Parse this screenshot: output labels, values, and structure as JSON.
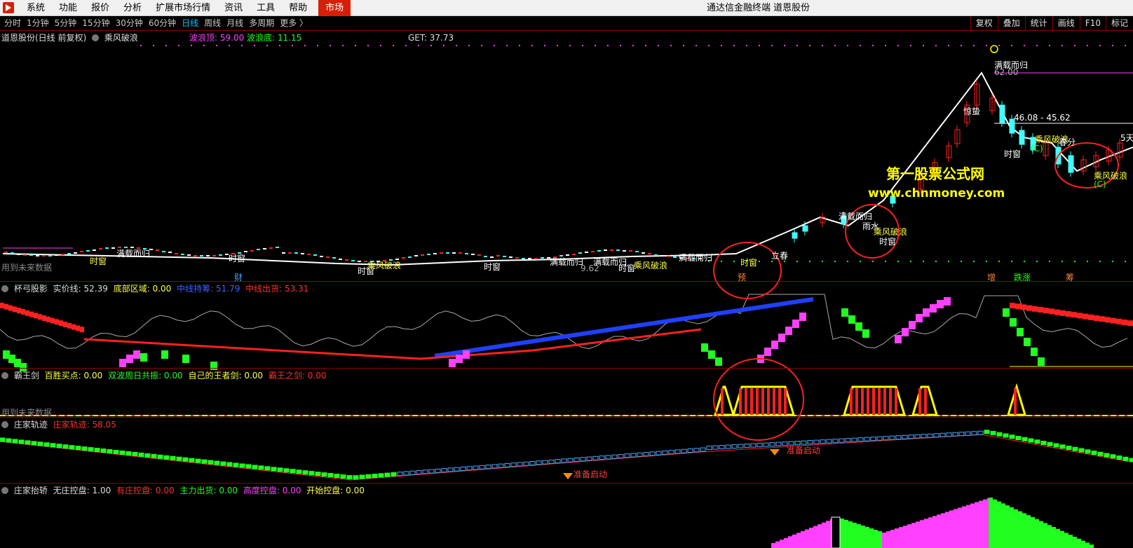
{
  "menu": {
    "items": [
      "系统",
      "功能",
      "报价",
      "分析",
      "扩展市场行情",
      "资讯",
      "工具",
      "帮助"
    ],
    "market": "市场",
    "title": "通达信金融终端 道恩股份"
  },
  "toolbar": {
    "periods": [
      "分时",
      "1分钟",
      "5分钟",
      "15分钟",
      "30分钟",
      "60分钟",
      "日线",
      "周线",
      "月线",
      "多周期",
      "更多 〉"
    ],
    "active": "日线",
    "right": [
      "复权",
      "叠加",
      "统计",
      "画线",
      "F10",
      "标记"
    ]
  },
  "panels": {
    "main": {
      "name": "道恩股份(日线 前复权)",
      "indicator": "乘风破浪",
      "wave_top": "波浪顶: 59.00",
      "wave_bottom": "波浪底: 11.15",
      "get": "GET: 37.73",
      "future_note": "用到未来数据",
      "price_range": "46.08 - 45.62",
      "peak_price": "62.00",
      "low_price": "9.62",
      "labels": {
        "manzai": "满载而归",
        "shichuang": "时窗",
        "chengfeng": "乘风破浪",
        "jingzhe": "惊蛰",
        "yushui": "雨水",
        "chunfen": "春分",
        "lichun": "立春",
        "c_mark": "(C)",
        "wu_tian": "5天",
        "cai": "财",
        "yu": "预",
        "zeng": "增",
        "diezhang": "跌涨",
        "chou": "筹"
      }
    },
    "beigong": {
      "name": "杯弓股影",
      "shijia": "实价线: 52.39",
      "dibu": "底部区域: 0.00",
      "zhongxian_chichou": "中线持筹: 51.79",
      "zhongxian_chuhuo": "中线出货: 53.31"
    },
    "bawang": {
      "name": "霸王剑",
      "baisheng": "百胜买点: 0.00",
      "shuangbo": "双波周日共振: 0.00",
      "wangzhe": "自己的王者剑: 0.00",
      "bawangzhijian": "霸王之剑: 0.00",
      "future_note": "用到未来数据"
    },
    "zhuangjia": {
      "name": "庄家轨迹",
      "guiji": "庄家轨迹: 58.05",
      "zhunbei": "准备启动"
    },
    "taiqiao": {
      "name": "庄家抬轿",
      "wuzhuang": "无庄控盘: 1.00",
      "youzhuang": "有庄控盘: 0.00",
      "zhuli": "主力出货: 0.00",
      "gaodu": "高度控盘: 0.00",
      "kaishi": "开始控盘: 0.00"
    }
  },
  "watermark": {
    "line1": "第一股票公式网",
    "line2": "www.chnmoney.com"
  },
  "colors": {
    "red": "#ff2020",
    "green": "#20ff20",
    "magenta": "#ff40ff",
    "blue": "#2040ff",
    "yellow": "#ffff00",
    "cyan": "#40ffff",
    "accent_red": "#d81e06"
  }
}
